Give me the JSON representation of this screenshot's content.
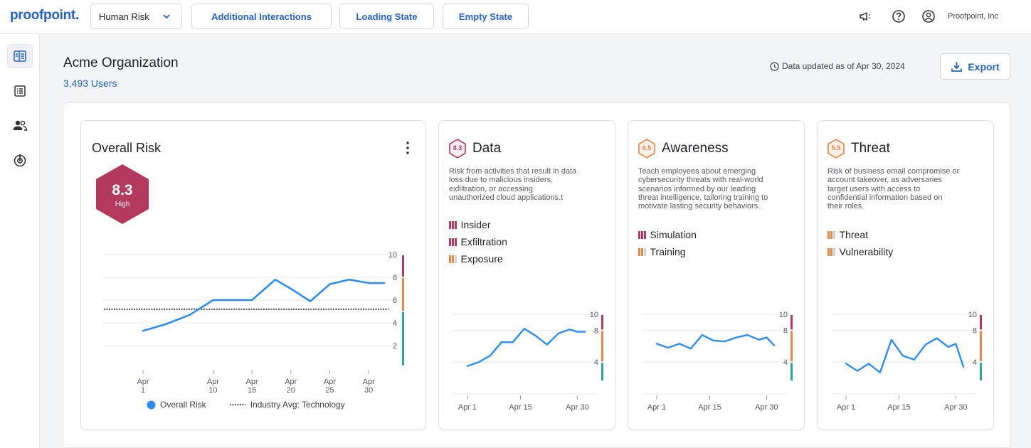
{
  "brand": {
    "logo": "proofpoint."
  },
  "topbar": {
    "selector_value": "Human Risk",
    "buttons": [
      "Additional Interactions",
      "Loading State",
      "Empty State"
    ],
    "org_name": "Proofpoint, Inc"
  },
  "header": {
    "title": "Acme Organization",
    "users": "3,493 Users",
    "updated": "Data updated as of Apr 30, 2024",
    "export_label": "Export"
  },
  "colors": {
    "high": "#b23a5c",
    "medium": "#e8874a",
    "low": "#2aa597",
    "line": "#2f8df0",
    "accent": "#2563c9"
  },
  "overall": {
    "title": "Overall Risk",
    "score": "8.3",
    "level": "High",
    "legend_series": "Overall Risk",
    "legend_avg": "Industry Avg: Technology"
  },
  "cards": [
    {
      "title": "Data",
      "score": "8.3",
      "level_color": "#b23a5c",
      "desc_lines": [
        "Risk from activities that result in data",
        "loss due to malicious insiders,",
        "exfiltration, or accessing",
        "unauthorized cloud applications.t"
      ],
      "items": [
        {
          "label": "Insider",
          "level": 3
        },
        {
          "label": "Exfiltration",
          "level": 3
        },
        {
          "label": "Exposure",
          "level": 2
        }
      ]
    },
    {
      "title": "Awareness",
      "score": "6.5",
      "level_color": "#e8874a",
      "desc_lines": [
        "Teach employees about emerging",
        "cybersecurity threats with real-world",
        "scenarios informed by our leading",
        "threat intelligence, tailoring training to",
        "motivate lasting security behaviors."
      ],
      "items": [
        {
          "label": "Simulation",
          "level": 3
        },
        {
          "label": "Training",
          "level": 2
        }
      ]
    },
    {
      "title": "Threat",
      "score": "5.5",
      "level_color": "#e8874a",
      "desc_lines": [
        "Risk of business email compromise or",
        "account takeover, as adversaries",
        "target users with access to",
        "confidential information based on",
        "their roles."
      ],
      "items": [
        {
          "label": "Threat",
          "level": 2
        },
        {
          "label": "Vulnerability",
          "level": 2
        }
      ]
    }
  ],
  "chart_data": [
    {
      "type": "line",
      "name": "overall",
      "x": [
        1,
        4,
        7,
        10,
        15,
        18,
        20,
        22.5,
        25,
        27.5,
        30,
        32
      ],
      "xticks": [
        {
          "x": 1,
          "l1": "Apr",
          "l2": "1"
        },
        {
          "x": 10,
          "l1": "Apr",
          "l2": "10"
        },
        {
          "x": 15,
          "l1": "Apr",
          "l2": "15"
        },
        {
          "x": 20,
          "l1": "Apr",
          "l2": "20"
        },
        {
          "x": 25,
          "l1": "Apr",
          "l2": "25"
        },
        {
          "x": 30,
          "l1": "Apr",
          "l2": "30"
        }
      ],
      "series": [
        {
          "name": "Overall Risk",
          "values": [
            3.3,
            3.9,
            4.7,
            6.0,
            6.0,
            7.8,
            7.0,
            5.9,
            7.4,
            7.8,
            7.5,
            7.5
          ]
        }
      ],
      "industry_avg": 5.2,
      "yticks": [
        2,
        4,
        6,
        8,
        10
      ],
      "ylim": [
        0,
        10
      ]
    },
    {
      "type": "line",
      "name": "data",
      "x": [
        1,
        4,
        7,
        10,
        13,
        16,
        19,
        22,
        25,
        28,
        30,
        32
      ],
      "xticks": [
        {
          "x": 1,
          "l1": "Apr 1"
        },
        {
          "x": 15,
          "l1": "Apr 15"
        },
        {
          "x": 30,
          "l1": "Apr 30"
        }
      ],
      "series": [
        {
          "name": "Data",
          "values": [
            3.5,
            4.0,
            4.8,
            6.5,
            6.5,
            8.2,
            7.3,
            6.2,
            7.6,
            8.1,
            7.8,
            7.8
          ]
        }
      ],
      "yticks": [
        4,
        8,
        10
      ],
      "ylim": [
        0,
        10
      ]
    },
    {
      "type": "line",
      "name": "awareness",
      "x": [
        1,
        4,
        7,
        10,
        13,
        16,
        19,
        22,
        25,
        28,
        30,
        32
      ],
      "xticks": [
        {
          "x": 1,
          "l1": "Apr 1"
        },
        {
          "x": 15,
          "l1": "Apr 15"
        },
        {
          "x": 30,
          "l1": "Apr 30"
        }
      ],
      "series": [
        {
          "name": "Awareness",
          "values": [
            6.3,
            5.8,
            6.3,
            5.7,
            7.4,
            6.7,
            6.6,
            7.1,
            7.4,
            6.8,
            7.1,
            6.1
          ]
        }
      ],
      "yticks": [
        4,
        8,
        10
      ],
      "ylim": [
        0,
        10
      ]
    },
    {
      "type": "line",
      "name": "threat",
      "x": [
        1,
        4,
        7,
        10,
        13,
        16,
        19,
        22,
        25,
        28,
        30,
        32
      ],
      "xticks": [
        {
          "x": 1,
          "l1": "Apr 1"
        },
        {
          "x": 15,
          "l1": "Apr 15"
        },
        {
          "x": 30,
          "l1": "Apr 30"
        }
      ],
      "series": [
        {
          "name": "Threat",
          "values": [
            3.8,
            2.9,
            3.8,
            2.7,
            6.8,
            4.8,
            4.3,
            6.2,
            7.0,
            5.9,
            6.3,
            3.4
          ]
        }
      ],
      "yticks": [
        4,
        8,
        10
      ],
      "ylim": [
        0,
        10
      ]
    }
  ]
}
